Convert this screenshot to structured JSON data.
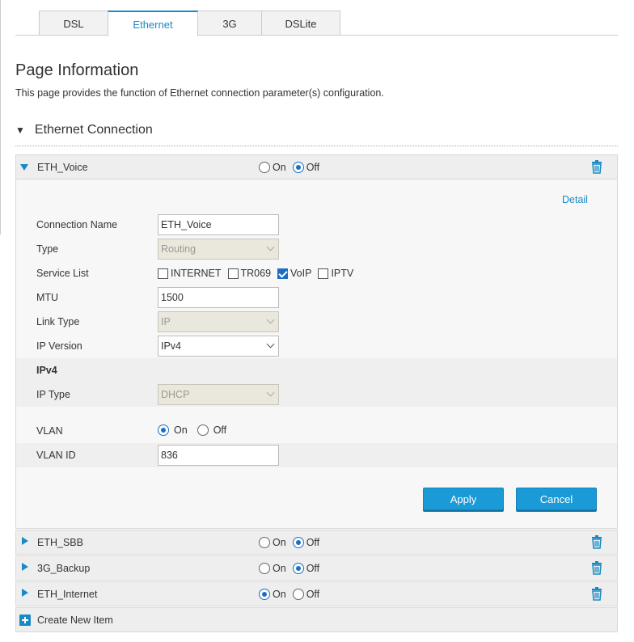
{
  "tabs": [
    {
      "label": "DSL",
      "active": false
    },
    {
      "label": "Ethernet",
      "active": true
    },
    {
      "label": "3G",
      "active": false
    },
    {
      "label": "DSLite",
      "active": false
    }
  ],
  "page": {
    "title": "Page Information",
    "description": "This page provides the function of Ethernet connection parameter(s) configuration."
  },
  "section": {
    "title": "Ethernet Connection"
  },
  "toggle_labels": {
    "on": "On",
    "off": "Off"
  },
  "connections": [
    {
      "name": "ETH_Voice",
      "state": "off",
      "expanded": true
    },
    {
      "name": "ETH_SBB",
      "state": "off",
      "expanded": false
    },
    {
      "name": "3G_Backup",
      "state": "off",
      "expanded": false
    },
    {
      "name": "ETH_Internet",
      "state": "on",
      "expanded": false
    }
  ],
  "form": {
    "detail_link": "Detail",
    "connection_name_label": "Connection Name",
    "connection_name_value": "ETH_Voice",
    "type_label": "Type",
    "type_value": "Routing",
    "service_list_label": "Service List",
    "services": [
      {
        "label": "INTERNET",
        "checked": false
      },
      {
        "label": "TR069",
        "checked": false
      },
      {
        "label": "VoIP",
        "checked": true
      },
      {
        "label": "IPTV",
        "checked": false
      }
    ],
    "mtu_label": "MTU",
    "mtu_value": "1500",
    "link_type_label": "Link Type",
    "link_type_value": "IP",
    "ip_version_label": "IP Version",
    "ip_version_value": "IPv4",
    "ipv4_header": "IPv4",
    "ip_type_label": "IP Type",
    "ip_type_value": "DHCP",
    "vlan_label": "VLAN",
    "vlan_state": "on",
    "vlan_id_label": "VLAN ID",
    "vlan_id_value": "836",
    "apply_label": "Apply",
    "cancel_label": "Cancel"
  },
  "create_new": {
    "label": "Create New Item"
  },
  "colors": {
    "accent": "#1a8ac4",
    "button": "#1a9ad6"
  }
}
